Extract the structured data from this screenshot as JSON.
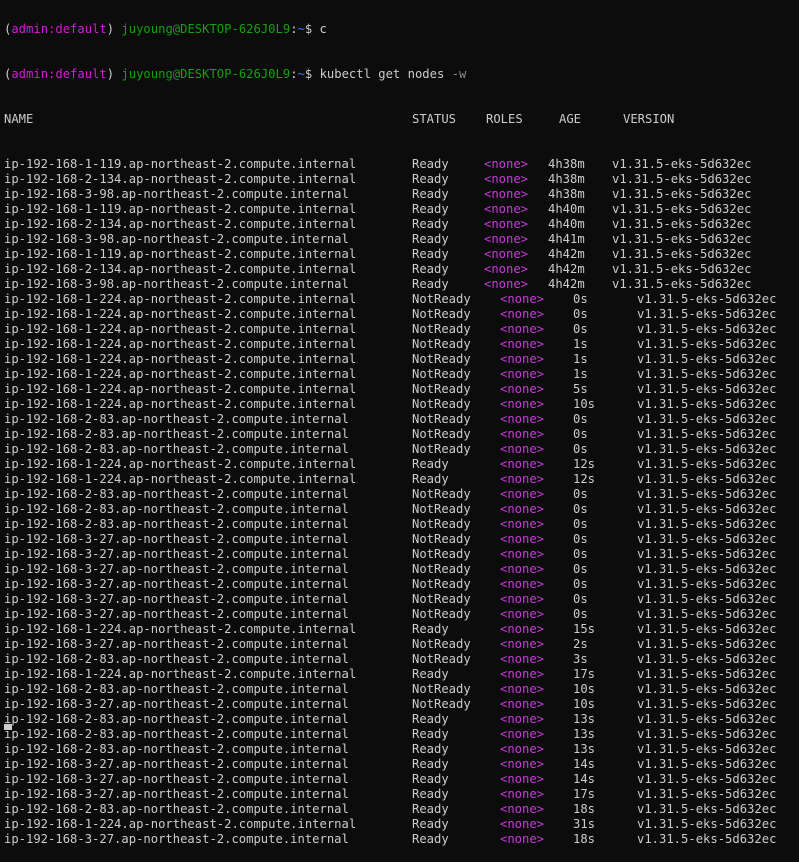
{
  "colors": {
    "background": "#0c0c0c",
    "text": "#cccccc",
    "env_name": "#d61ad6",
    "prompt_user": "#13a10e",
    "prompt_path": "#3b78ff",
    "roles_none": "#c83bd9"
  },
  "previous_prompt": {
    "env_open": "(",
    "env_name": "admin:default",
    "env_close": ") ",
    "user_host": "juyoung@DESKTOP-626J0L9",
    "sep": ":",
    "path": "~",
    "suffix": "$ c"
  },
  "prompt": {
    "env_open": "(",
    "env_name": "admin:default",
    "env_close": ") ",
    "user_host": "juyoung@DESKTOP-626J0L9",
    "sep": ":",
    "path": "~",
    "dollar": "$ ",
    "command": "kubectl get nodes ",
    "flag": "-w"
  },
  "table": {
    "headers": [
      "NAME",
      "STATUS",
      "ROLES",
      "AGE",
      "VERSION"
    ],
    "rows": [
      {
        "name": "ip-192-168-1-119.ap-northeast-2.compute.internal",
        "status": "Ready",
        "roles": "<none>",
        "age": "4h38m",
        "version": "v1.31.5-eks-5d632ec"
      },
      {
        "name": "ip-192-168-2-134.ap-northeast-2.compute.internal",
        "status": "Ready",
        "roles": "<none>",
        "age": "4h38m",
        "version": "v1.31.5-eks-5d632ec"
      },
      {
        "name": "ip-192-168-3-98.ap-northeast-2.compute.internal",
        "status": "Ready",
        "roles": "<none>",
        "age": "4h38m",
        "version": "v1.31.5-eks-5d632ec"
      },
      {
        "name": "ip-192-168-1-119.ap-northeast-2.compute.internal",
        "status": "Ready",
        "roles": "<none>",
        "age": "4h40m",
        "version": "v1.31.5-eks-5d632ec"
      },
      {
        "name": "ip-192-168-2-134.ap-northeast-2.compute.internal",
        "status": "Ready",
        "roles": "<none>",
        "age": "4h40m",
        "version": "v1.31.5-eks-5d632ec"
      },
      {
        "name": "ip-192-168-3-98.ap-northeast-2.compute.internal",
        "status": "Ready",
        "roles": "<none>",
        "age": "4h41m",
        "version": "v1.31.5-eks-5d632ec"
      },
      {
        "name": "ip-192-168-1-119.ap-northeast-2.compute.internal",
        "status": "Ready",
        "roles": "<none>",
        "age": "4h42m",
        "version": "v1.31.5-eks-5d632ec"
      },
      {
        "name": "ip-192-168-2-134.ap-northeast-2.compute.internal",
        "status": "Ready",
        "roles": "<none>",
        "age": "4h42m",
        "version": "v1.31.5-eks-5d632ec"
      },
      {
        "name": "ip-192-168-3-98.ap-northeast-2.compute.internal",
        "status": "Ready",
        "roles": "<none>",
        "age": "4h42m",
        "version": "v1.31.5-eks-5d632ec"
      },
      {
        "name": "ip-192-168-1-224.ap-northeast-2.compute.internal",
        "status": "NotReady",
        "roles": "<none>",
        "age": "0s",
        "version": "v1.31.5-eks-5d632ec"
      },
      {
        "name": "ip-192-168-1-224.ap-northeast-2.compute.internal",
        "status": "NotReady",
        "roles": "<none>",
        "age": "0s",
        "version": "v1.31.5-eks-5d632ec"
      },
      {
        "name": "ip-192-168-1-224.ap-northeast-2.compute.internal",
        "status": "NotReady",
        "roles": "<none>",
        "age": "0s",
        "version": "v1.31.5-eks-5d632ec"
      },
      {
        "name": "ip-192-168-1-224.ap-northeast-2.compute.internal",
        "status": "NotReady",
        "roles": "<none>",
        "age": "1s",
        "version": "v1.31.5-eks-5d632ec"
      },
      {
        "name": "ip-192-168-1-224.ap-northeast-2.compute.internal",
        "status": "NotReady",
        "roles": "<none>",
        "age": "1s",
        "version": "v1.31.5-eks-5d632ec"
      },
      {
        "name": "ip-192-168-1-224.ap-northeast-2.compute.internal",
        "status": "NotReady",
        "roles": "<none>",
        "age": "1s",
        "version": "v1.31.5-eks-5d632ec"
      },
      {
        "name": "ip-192-168-1-224.ap-northeast-2.compute.internal",
        "status": "NotReady",
        "roles": "<none>",
        "age": "5s",
        "version": "v1.31.5-eks-5d632ec"
      },
      {
        "name": "ip-192-168-1-224.ap-northeast-2.compute.internal",
        "status": "NotReady",
        "roles": "<none>",
        "age": "10s",
        "version": "v1.31.5-eks-5d632ec"
      },
      {
        "name": "ip-192-168-2-83.ap-northeast-2.compute.internal",
        "status": "NotReady",
        "roles": "<none>",
        "age": "0s",
        "version": "v1.31.5-eks-5d632ec"
      },
      {
        "name": "ip-192-168-2-83.ap-northeast-2.compute.internal",
        "status": "NotReady",
        "roles": "<none>",
        "age": "0s",
        "version": "v1.31.5-eks-5d632ec"
      },
      {
        "name": "ip-192-168-2-83.ap-northeast-2.compute.internal",
        "status": "NotReady",
        "roles": "<none>",
        "age": "0s",
        "version": "v1.31.5-eks-5d632ec"
      },
      {
        "name": "ip-192-168-1-224.ap-northeast-2.compute.internal",
        "status": "Ready",
        "roles": "<none>",
        "age": "12s",
        "version": "v1.31.5-eks-5d632ec"
      },
      {
        "name": "ip-192-168-1-224.ap-northeast-2.compute.internal",
        "status": "Ready",
        "roles": "<none>",
        "age": "12s",
        "version": "v1.31.5-eks-5d632ec"
      },
      {
        "name": "ip-192-168-2-83.ap-northeast-2.compute.internal",
        "status": "NotReady",
        "roles": "<none>",
        "age": "0s",
        "version": "v1.31.5-eks-5d632ec"
      },
      {
        "name": "ip-192-168-2-83.ap-northeast-2.compute.internal",
        "status": "NotReady",
        "roles": "<none>",
        "age": "0s",
        "version": "v1.31.5-eks-5d632ec"
      },
      {
        "name": "ip-192-168-2-83.ap-northeast-2.compute.internal",
        "status": "NotReady",
        "roles": "<none>",
        "age": "0s",
        "version": "v1.31.5-eks-5d632ec"
      },
      {
        "name": "ip-192-168-3-27.ap-northeast-2.compute.internal",
        "status": "NotReady",
        "roles": "<none>",
        "age": "0s",
        "version": "v1.31.5-eks-5d632ec"
      },
      {
        "name": "ip-192-168-3-27.ap-northeast-2.compute.internal",
        "status": "NotReady",
        "roles": "<none>",
        "age": "0s",
        "version": "v1.31.5-eks-5d632ec"
      },
      {
        "name": "ip-192-168-3-27.ap-northeast-2.compute.internal",
        "status": "NotReady",
        "roles": "<none>",
        "age": "0s",
        "version": "v1.31.5-eks-5d632ec"
      },
      {
        "name": "ip-192-168-3-27.ap-northeast-2.compute.internal",
        "status": "NotReady",
        "roles": "<none>",
        "age": "0s",
        "version": "v1.31.5-eks-5d632ec"
      },
      {
        "name": "ip-192-168-3-27.ap-northeast-2.compute.internal",
        "status": "NotReady",
        "roles": "<none>",
        "age": "0s",
        "version": "v1.31.5-eks-5d632ec"
      },
      {
        "name": "ip-192-168-3-27.ap-northeast-2.compute.internal",
        "status": "NotReady",
        "roles": "<none>",
        "age": "0s",
        "version": "v1.31.5-eks-5d632ec"
      },
      {
        "name": "ip-192-168-1-224.ap-northeast-2.compute.internal",
        "status": "Ready",
        "roles": "<none>",
        "age": "15s",
        "version": "v1.31.5-eks-5d632ec"
      },
      {
        "name": "ip-192-168-3-27.ap-northeast-2.compute.internal",
        "status": "NotReady",
        "roles": "<none>",
        "age": "2s",
        "version": "v1.31.5-eks-5d632ec"
      },
      {
        "name": "ip-192-168-2-83.ap-northeast-2.compute.internal",
        "status": "NotReady",
        "roles": "<none>",
        "age": "3s",
        "version": "v1.31.5-eks-5d632ec"
      },
      {
        "name": "ip-192-168-1-224.ap-northeast-2.compute.internal",
        "status": "Ready",
        "roles": "<none>",
        "age": "17s",
        "version": "v1.31.5-eks-5d632ec"
      },
      {
        "name": "ip-192-168-2-83.ap-northeast-2.compute.internal",
        "status": "NotReady",
        "roles": "<none>",
        "age": "10s",
        "version": "v1.31.5-eks-5d632ec"
      },
      {
        "name": "ip-192-168-3-27.ap-northeast-2.compute.internal",
        "status": "NotReady",
        "roles": "<none>",
        "age": "10s",
        "version": "v1.31.5-eks-5d632ec"
      },
      {
        "name": "ip-192-168-2-83.ap-northeast-2.compute.internal",
        "status": "Ready",
        "roles": "<none>",
        "age": "13s",
        "version": "v1.31.5-eks-5d632ec"
      },
      {
        "name": "ip-192-168-2-83.ap-northeast-2.compute.internal",
        "status": "Ready",
        "roles": "<none>",
        "age": "13s",
        "version": "v1.31.5-eks-5d632ec"
      },
      {
        "name": "ip-192-168-2-83.ap-northeast-2.compute.internal",
        "status": "Ready",
        "roles": "<none>",
        "age": "13s",
        "version": "v1.31.5-eks-5d632ec"
      },
      {
        "name": "ip-192-168-3-27.ap-northeast-2.compute.internal",
        "status": "Ready",
        "roles": "<none>",
        "age": "14s",
        "version": "v1.31.5-eks-5d632ec"
      },
      {
        "name": "ip-192-168-3-27.ap-northeast-2.compute.internal",
        "status": "Ready",
        "roles": "<none>",
        "age": "14s",
        "version": "v1.31.5-eks-5d632ec"
      },
      {
        "name": "ip-192-168-3-27.ap-northeast-2.compute.internal",
        "status": "Ready",
        "roles": "<none>",
        "age": "17s",
        "version": "v1.31.5-eks-5d632ec"
      },
      {
        "name": "ip-192-168-2-83.ap-northeast-2.compute.internal",
        "status": "Ready",
        "roles": "<none>",
        "age": "18s",
        "version": "v1.31.5-eks-5d632ec"
      },
      {
        "name": "ip-192-168-1-224.ap-northeast-2.compute.internal",
        "status": "Ready",
        "roles": "<none>",
        "age": "31s",
        "version": "v1.31.5-eks-5d632ec"
      },
      {
        "name": "ip-192-168-3-27.ap-northeast-2.compute.internal",
        "status": "Ready",
        "roles": "<none>",
        "age": "18s",
        "version": "v1.31.5-eks-5d632ec"
      }
    ]
  }
}
